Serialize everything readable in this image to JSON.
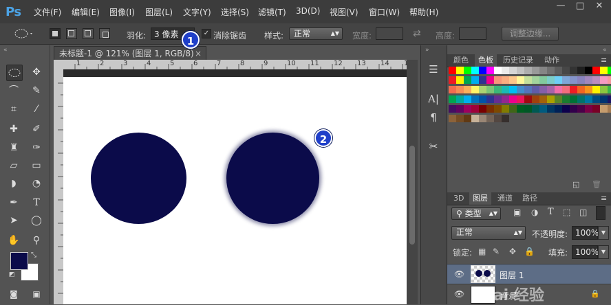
{
  "app": {
    "logo": "Ps"
  },
  "menu": [
    "文件(F)",
    "编辑(E)",
    "图像(I)",
    "图层(L)",
    "文字(Y)",
    "选择(S)",
    "滤镜(T)",
    "3D(D)",
    "视图(V)",
    "窗口(W)",
    "帮助(H)"
  ],
  "window_controls": {
    "minimize": "—",
    "maximize": "□",
    "close": "✕"
  },
  "options": {
    "feather_label": "羽化:",
    "feather_value": "3 像素",
    "antialias_label": "消除锯齿",
    "style_label": "样式:",
    "style_value": "正常",
    "width_label": "宽度:",
    "height_label": "高度:",
    "refine_edge_label": "调整边缘..."
  },
  "document": {
    "tab_title": "未标题-1 @ 121% (图层 1, RGB/8)",
    "tab_close": "×",
    "ruler_ticks": [
      "1",
      "2",
      "3",
      "4",
      "5",
      "6",
      "7",
      "8",
      "9",
      "10",
      "11",
      "12",
      "13",
      "14",
      "15"
    ],
    "circle_color": "#0b0b4a"
  },
  "callouts": {
    "one": "1",
    "two": "2"
  },
  "swatches_panel": {
    "tabs": [
      "颜色",
      "色板",
      "历史记录",
      "动作"
    ],
    "active_tab": "色板"
  },
  "layers_panel": {
    "tabs": [
      "3D",
      "图层",
      "通道",
      "路径"
    ],
    "active_tab": "图层",
    "filter_label": "类型",
    "blend_mode": "正常",
    "opacity_label": "不透明度:",
    "opacity_value": "100%",
    "lock_label": "锁定:",
    "fill_label": "填充:",
    "fill_value": "100%",
    "layers": [
      {
        "name": "图层 1"
      },
      {
        "name": "背景"
      }
    ]
  },
  "colors": {
    "foreground": "#0b0b4a",
    "background": "#ffffff",
    "accent": "#1f3fc9"
  },
  "watermark": "Bai 经验"
}
